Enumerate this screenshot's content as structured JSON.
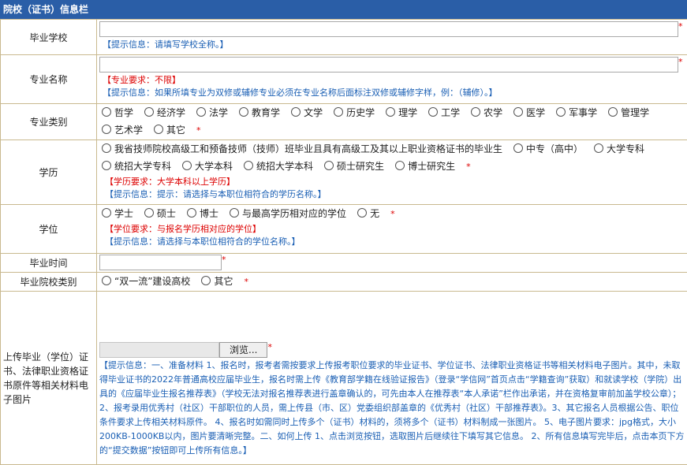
{
  "header": {
    "title": "院校（证书）信息栏"
  },
  "rows": {
    "school": {
      "label": "毕业学校",
      "hint": "【提示信息：请填写学校全称。】"
    },
    "major": {
      "label": "专业名称",
      "req": "【专业要求：不限】",
      "hint": "【提示信息：如果所填专业为双修或辅修专业必须在专业名称后面标注双修或辅修字样，例：（辅修）。】"
    },
    "category": {
      "label": "专业类别",
      "options": [
        "哲学",
        "经济学",
        "法学",
        "教育学",
        "文学",
        "历史学",
        "理学",
        "工学",
        "农学",
        "医学",
        "军事学",
        "管理学",
        "艺术学",
        "其它"
      ]
    },
    "education": {
      "label": "学历",
      "options": [
        "我省技师院校高级工和预备技师（技师）班毕业且具有高级工及其以上职业资格证书的毕业生",
        "中专（高中）",
        "大学专科",
        "统招大学专科",
        "大学本科",
        "统招大学本科",
        "硕士研究生",
        "博士研究生"
      ],
      "req": "【学历要求：大学本科以上学历】",
      "hint": "【提示信息：提示：请选择与本职位相符合的学历名称。】"
    },
    "degree": {
      "label": "学位",
      "options": [
        "学士",
        "硕士",
        "博士",
        "与最高学历相对应的学位",
        "无"
      ],
      "req": "【学位要求：与报名学历相对应的学位】",
      "hint": "【提示信息：请选择与本职位相符合的学位名称。】"
    },
    "gradtime": {
      "label": "毕业时间"
    },
    "schooltype": {
      "label": "毕业院校类别",
      "options": [
        "“双一流”建设高校",
        "其它"
      ]
    },
    "upload": {
      "label": "上传毕业（学位）证书、法律职业资格证书原件等相关材料电子图片",
      "browse": "浏览...",
      "hint": "【提示信息：一、准备材料 1、报名时，报考者需按要求上传报考职位要求的毕业证书、学位证书、法律职业资格证书等相关材料电子图片。其中，未取得毕业证书的2022年普通高校应届毕业生，报名时需上传《教育部学籍在线验证报告》（登录“学信网”首页点击“学籍查询”获取）和就读学校（学院）出具的《应届毕业生报名推荐表》（学校无法对报名推荐表进行盖章确认的，可先由本人在推荐表“本人承诺”栏作出承诺，并在资格复审前加盖学校公章）； 2、报考录用优秀村（社区）干部职位的人员，需上传县（市、区）党委组织部盖章的《优秀村（社区）干部推荐表》。3、其它报名人员根据公告、职位条件要求上传相关材料原件。 4、报名时如需同时上传多个（证书）材料的，须将多个（证书）材料制成一张图片。 5、电子图片要求：jpg格式，大小200KB-1000KB以内，图片要清晰完整。二、如何上传 1、点击浏览按钮，选取图片后继续往下填写其它信息。 2、所有信息填写完毕后，点击本页下方的“提交数据”按钮即可上传所有信息。】"
    }
  },
  "required_mark": "*",
  "colors": {
    "header_bg": "#2a5ea7",
    "hint": "#1a5fb4",
    "required": "#dd0000",
    "border": "#c9b98f"
  }
}
